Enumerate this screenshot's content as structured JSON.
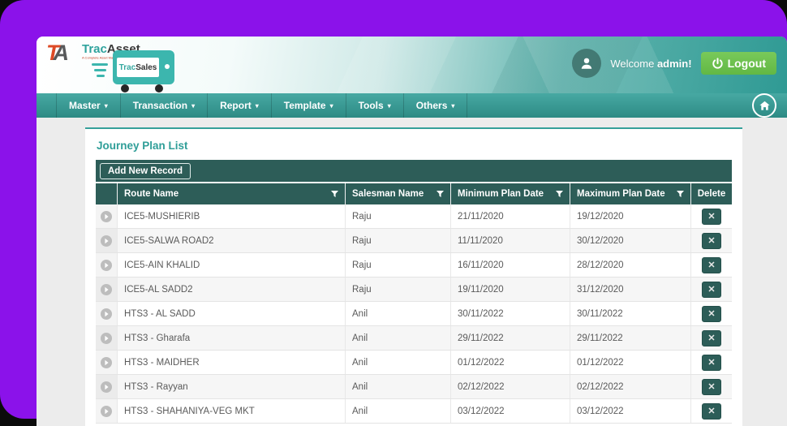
{
  "brand": {
    "monogram_t": "T",
    "monogram_a": "A",
    "name_primary": "Trac",
    "name_secondary": "Asset",
    "tagline": "A Complete Asset Management Solution",
    "truck_primary": "Trac",
    "truck_secondary": "Sales"
  },
  "header": {
    "welcome_prefix": "Welcome ",
    "username": "admin!",
    "logout_label": "Logout"
  },
  "nav": {
    "items": [
      "Master",
      "Transaction",
      "Report",
      "Template",
      "Tools",
      "Others"
    ]
  },
  "page": {
    "title": "Journey Plan List",
    "add_button_label": "Add New Record"
  },
  "table": {
    "columns": [
      "Route Name",
      "Salesman Name",
      "Minimum Plan Date",
      "Maximum Plan Date",
      "Delete"
    ],
    "rows": [
      {
        "route": "ICE5-MUSHIERIB",
        "salesman": "Raju",
        "min_date": "21/11/2020",
        "max_date": "19/12/2020"
      },
      {
        "route": "ICE5-SALWA ROAD2",
        "salesman": "Raju",
        "min_date": "11/11/2020",
        "max_date": "30/12/2020"
      },
      {
        "route": "ICE5-AIN KHALID",
        "salesman": "Raju",
        "min_date": "16/11/2020",
        "max_date": "28/12/2020"
      },
      {
        "route": "ICE5-AL SADD2",
        "salesman": "Raju",
        "min_date": "19/11/2020",
        "max_date": "31/12/2020"
      },
      {
        "route": "HTS3 - AL SADD",
        "salesman": "Anil",
        "min_date": "30/11/2022",
        "max_date": "30/11/2022"
      },
      {
        "route": "HTS3 - Gharafa",
        "salesman": "Anil",
        "min_date": "29/11/2022",
        "max_date": "29/11/2022"
      },
      {
        "route": "HTS3 - MAIDHER",
        "salesman": "Anil",
        "min_date": "01/12/2022",
        "max_date": "01/12/2022"
      },
      {
        "route": "HTS3 - Rayyan",
        "salesman": "Anil",
        "min_date": "02/12/2022",
        "max_date": "02/12/2022"
      },
      {
        "route": "HTS3 - SHAHANIYA-VEG MKT",
        "salesman": "Anil",
        "min_date": "03/12/2022",
        "max_date": "03/12/2022"
      }
    ]
  },
  "icons": {
    "avatar": "person-icon",
    "logout": "power-icon",
    "home": "home-icon",
    "filter": "funnel-filter-icon",
    "expander": "play-circle-icon",
    "caret_glyph": "▾",
    "delete_glyph": "✕"
  },
  "colors": {
    "purple_backdrop": "#8B12EA",
    "teal_accent": "#2F9E98",
    "dark_teal": "#2D5D58",
    "nav_teal": "#2E8B85",
    "logout_green": "#6CBF4B",
    "brand_red": "#DD4A26"
  }
}
